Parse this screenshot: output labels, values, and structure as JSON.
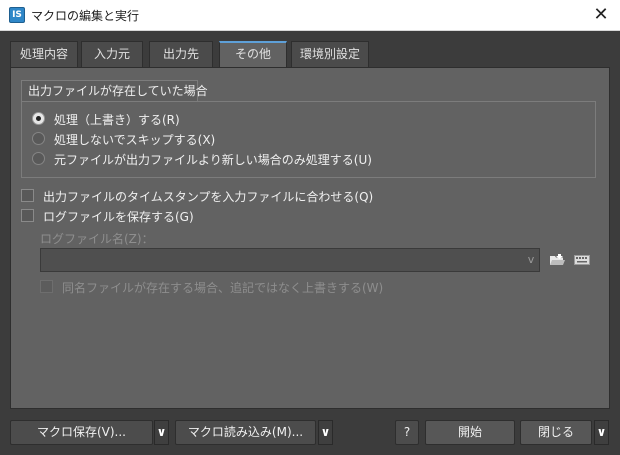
{
  "window": {
    "icon_text": "IS",
    "title": "マクロの編集と実行",
    "close_glyph": "✕"
  },
  "tabs": [
    {
      "label": "処理内容",
      "active": false
    },
    {
      "label": "入力元",
      "active": false
    },
    {
      "label": "出力先",
      "active": false
    },
    {
      "label": "その他",
      "active": true
    },
    {
      "label": "環境別設定",
      "active": false
    }
  ],
  "group": {
    "label": "出力ファイルが存在していた場合",
    "options": [
      {
        "label": "処理（上書き）する(R)",
        "selected": true
      },
      {
        "label": "処理しないでスキップする(X)",
        "selected": false
      },
      {
        "label": "元ファイルが出力ファイルより新しい場合のみ処理する(U)",
        "selected": false
      }
    ]
  },
  "checkboxes": {
    "timestamp": {
      "label": "出力ファイルのタイムスタンプを入力ファイルに合わせる(Q)",
      "checked": false
    },
    "save_log": {
      "label": "ログファイルを保存する(G)",
      "checked": false
    }
  },
  "log": {
    "filename_label": "ログファイル名(Z)：",
    "filename_value": "",
    "dropdown_glyph": "v",
    "overwrite_label": "同名ファイルが存在する場合、追記ではなく上書きする(W)",
    "icons": [
      "folder-open-icon",
      "keyboard-icon"
    ]
  },
  "footer": {
    "save_macro": "マクロ保存(V)...",
    "load_macro": "マクロ読み込み(M)...",
    "help": "?",
    "start": "開始",
    "close": "閉じる",
    "chevron": "∨"
  },
  "colors": {
    "panel": "#626262",
    "window": "#3c3c3c",
    "active_tab_accent": "#5ea0d8"
  }
}
